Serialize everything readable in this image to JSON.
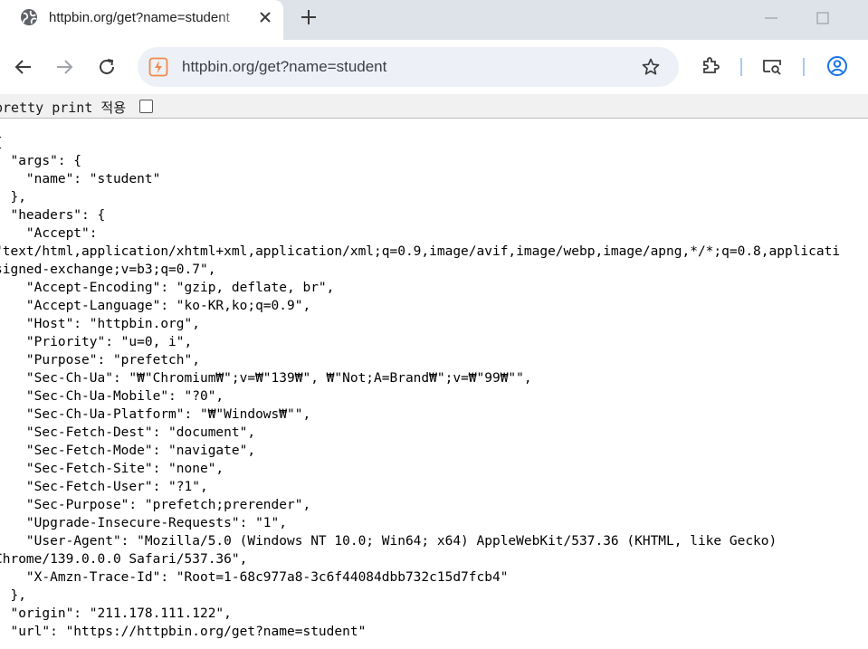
{
  "tab": {
    "title": "httpbin.org/get?name=student"
  },
  "toolbar": {
    "url": "httpbin.org/get?name=student"
  },
  "pretty_print": {
    "label": "pretty print 적용",
    "checked": false
  },
  "icons": {
    "tab": "globe-icon",
    "close": "close-icon",
    "new_tab": "plus-icon",
    "back": "back-arrow-icon",
    "forward": "forward-arrow-icon",
    "reload": "reload-icon",
    "site": "site-info-icon",
    "bookmark": "star-icon",
    "extensions": "puzzle-icon",
    "cast": "cast-search-icon",
    "profile": "profile-icon"
  },
  "colors": {
    "tabbar_bg": "#dee3ea",
    "omnibox_bg": "#edf1f7",
    "accent": "#1a73e8",
    "site_icon": "#f08a4b"
  },
  "json_lines": [
    "{",
    "  \"args\": {",
    "    \"name\": \"student\"",
    "  },",
    "  \"headers\": {",
    "    \"Accept\":",
    "\"text/html,application/xhtml+xml,application/xml;q=0.9,image/avif,image/webp,image/apng,*/*;q=0.8,applicati",
    "signed-exchange;v=b3;q=0.7\",",
    "    \"Accept-Encoding\": \"gzip, deflate, br\",",
    "    \"Accept-Language\": \"ko-KR,ko;q=0.9\",",
    "    \"Host\": \"httpbin.org\",",
    "    \"Priority\": \"u=0, i\",",
    "    \"Purpose\": \"prefetch\",",
    "    \"Sec-Ch-Ua\": \"₩\"Chromium₩\";v=₩\"139₩\", ₩\"Not;A=Brand₩\";v=₩\"99₩\"\",",
    "    \"Sec-Ch-Ua-Mobile\": \"?0\",",
    "    \"Sec-Ch-Ua-Platform\": \"₩\"Windows₩\"\",",
    "    \"Sec-Fetch-Dest\": \"document\",",
    "    \"Sec-Fetch-Mode\": \"navigate\",",
    "    \"Sec-Fetch-Site\": \"none\",",
    "    \"Sec-Fetch-User\": \"?1\",",
    "    \"Sec-Purpose\": \"prefetch;prerender\",",
    "    \"Upgrade-Insecure-Requests\": \"1\",",
    "    \"User-Agent\": \"Mozilla/5.0 (Windows NT 10.0; Win64; x64) AppleWebKit/537.36 (KHTML, like Gecko)",
    "Chrome/139.0.0.0 Safari/537.36\",",
    "    \"X-Amzn-Trace-Id\": \"Root=1-68c977a8-3c6f44084dbb732c15d7fcb4\"",
    "  },",
    "  \"origin\": \"211.178.111.122\",",
    "  \"url\": \"https://httpbin.org/get?name=student\""
  ]
}
